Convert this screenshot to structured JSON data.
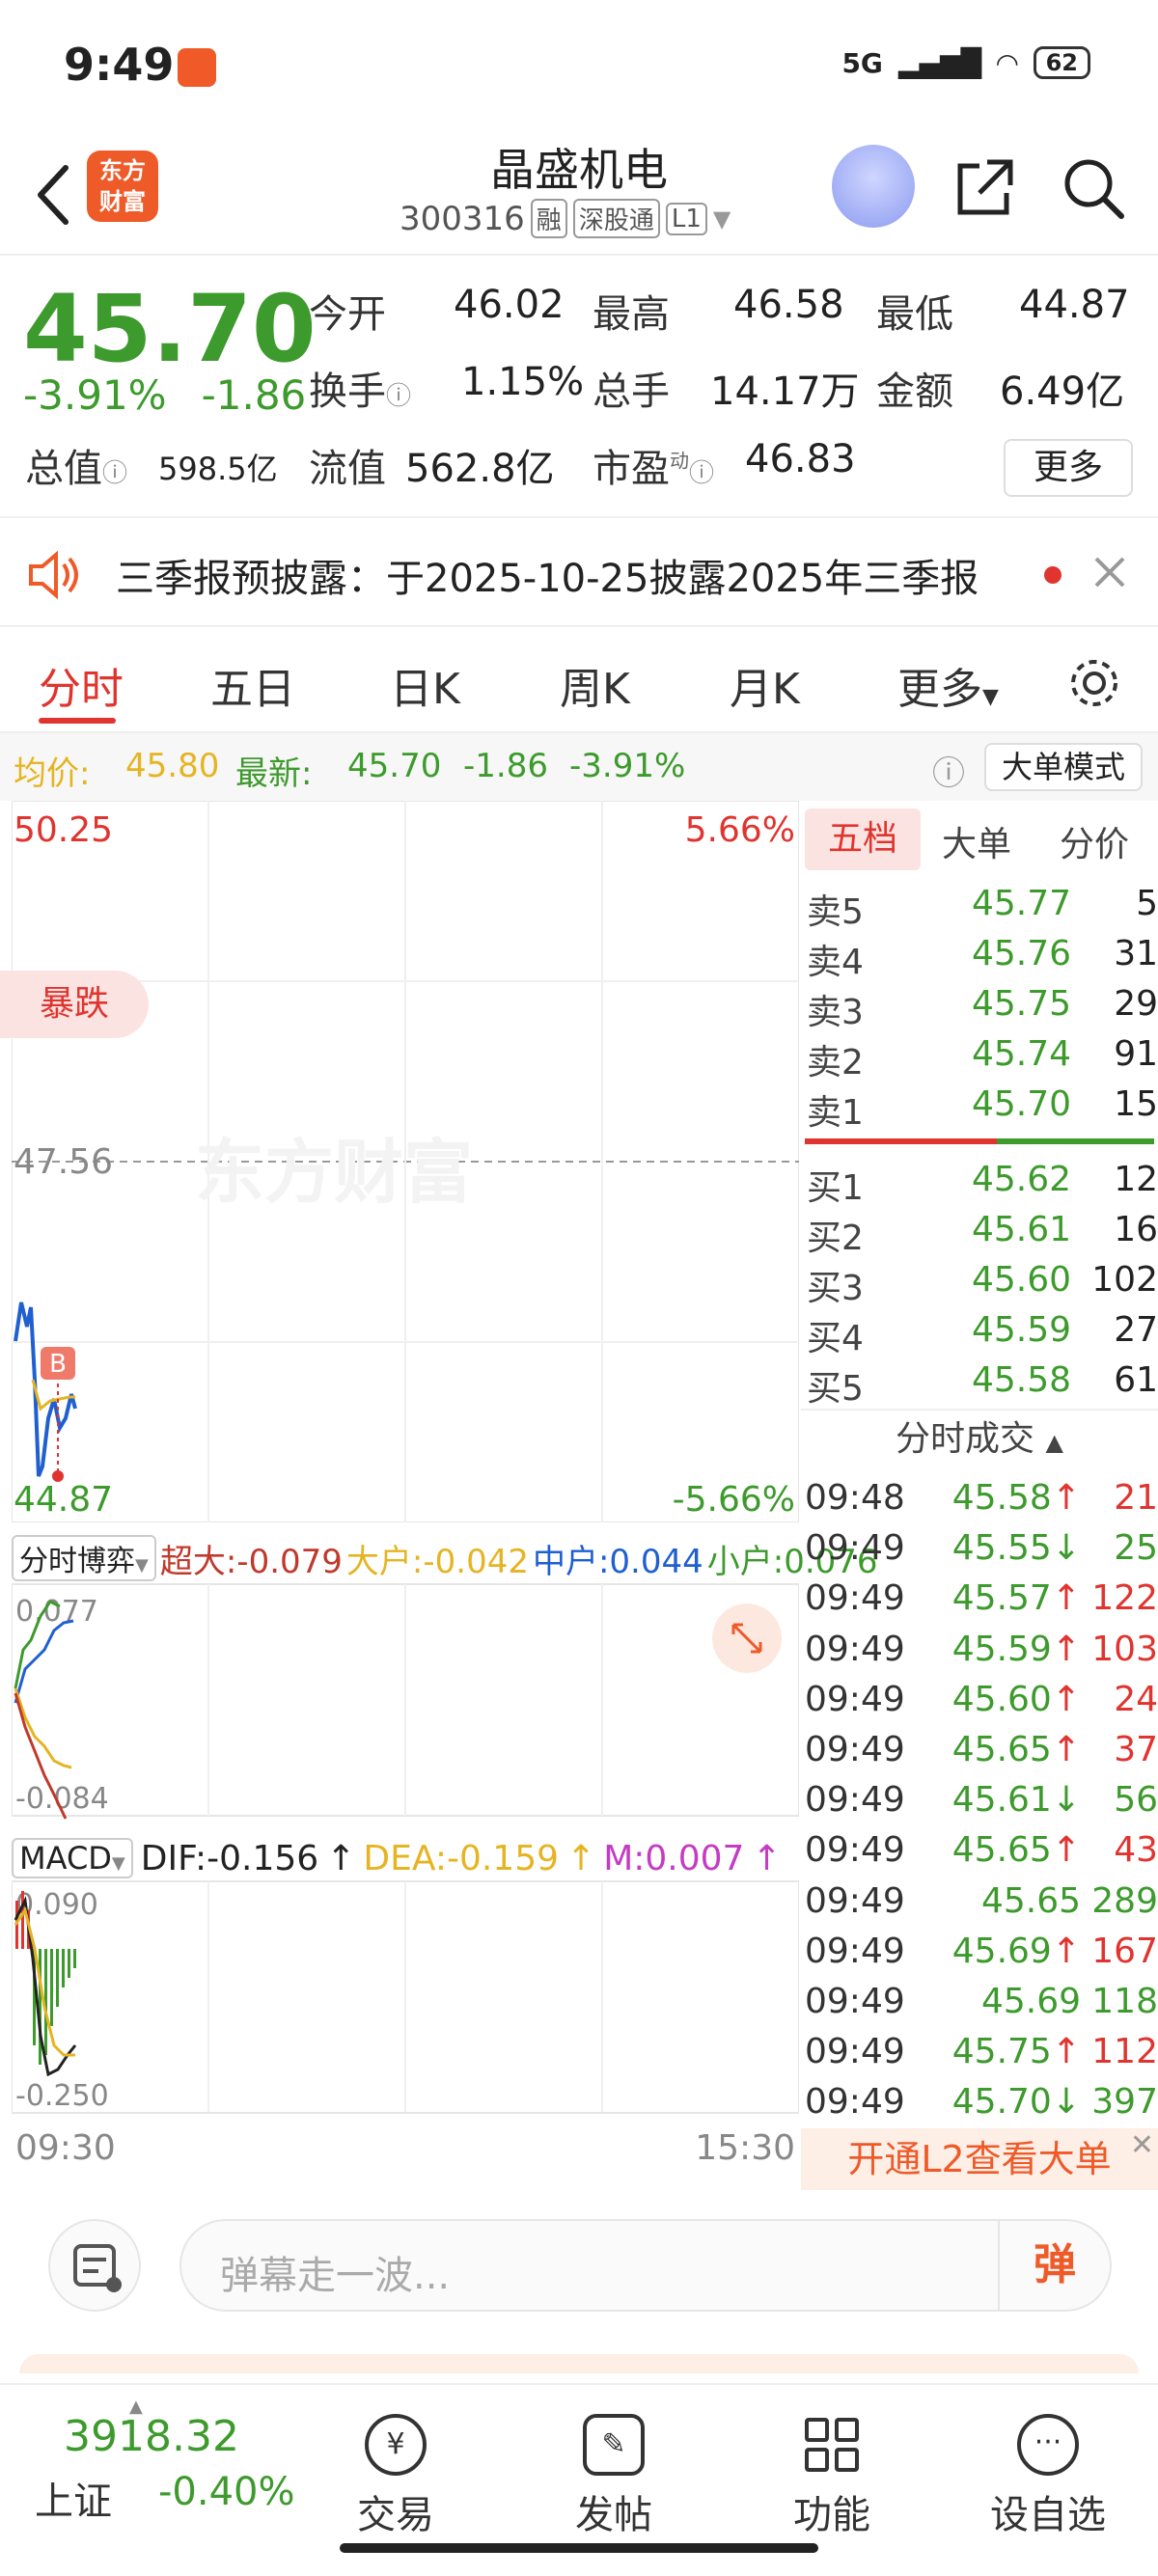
{
  "status": {
    "time": "9:49",
    "network": "5G",
    "battery": "62"
  },
  "header": {
    "logo_line1": "东方",
    "logo_line2": "财富",
    "name": "晶盛机电",
    "code": "300316",
    "tags": [
      "融",
      "深股通",
      "L1"
    ]
  },
  "quote": {
    "price": "45.70",
    "change_pct": "-3.91%",
    "change": "-1.86",
    "open_label": "今开",
    "open": "46.02",
    "high_label": "最高",
    "high": "46.58",
    "low_label": "最低",
    "low": "44.87",
    "turnover_label": "换手",
    "turnover": "1.15%",
    "volume_label": "总手",
    "volume": "14.17万",
    "amount_label": "金额",
    "amount": "6.49亿",
    "mktcap_label": "总值",
    "mktcap": "598.5亿",
    "float_label": "流值",
    "float": "562.8亿",
    "pe_label": "市盈",
    "pe_sup": "动",
    "pe": "46.83",
    "more": "更多"
  },
  "notice": {
    "text": "三季报预披露：于2025-10-25披露2025年三季报"
  },
  "tabs": [
    "分时",
    "五日",
    "日K",
    "周K",
    "月K",
    "更多"
  ],
  "avgbar": {
    "avg_label": "均价:",
    "avg": "45.80",
    "latest_label": "最新:",
    "latest": "45.70",
    "chg": "-1.86",
    "pct": "-3.91%",
    "mode": "大单模式"
  },
  "chart": {
    "top_price": "50.25",
    "top_pct": "5.66%",
    "mid_price": "47.56",
    "bot_price": "44.87",
    "bot_pct": "-5.66%",
    "badge": "暴跌",
    "watermark": "东方财富",
    "b_mark": "B",
    "flow_selector": "分时博弈",
    "flow": {
      "super": "超大:-0.079",
      "large": "大户:-0.042",
      "mid": "中户:0.044",
      "small": "小户:0.076"
    },
    "flow_top": "0.077",
    "flow_bot": "-0.084",
    "macd_selector": "MACD",
    "macd": {
      "dif": "DIF:-0.156",
      "dea": "DEA:-0.159",
      "m": "M:0.007"
    },
    "macd_top": "0.090",
    "macd_bot": "-0.250",
    "time_start": "09:30",
    "time_end": "15:30",
    "colors": {
      "up": "#e0342f",
      "down": "#3d9a2c",
      "price_line": "#1f5fd0",
      "avg_line": "#e6b422"
    }
  },
  "orderbook": {
    "tabs": [
      "五档",
      "大单",
      "分价"
    ],
    "asks": [
      {
        "label": "卖5",
        "price": "45.77",
        "vol": "5"
      },
      {
        "label": "卖4",
        "price": "45.76",
        "vol": "31"
      },
      {
        "label": "卖3",
        "price": "45.75",
        "vol": "29"
      },
      {
        "label": "卖2",
        "price": "45.74",
        "vol": "91"
      },
      {
        "label": "卖1",
        "price": "45.70",
        "vol": "15"
      }
    ],
    "bids": [
      {
        "label": "买1",
        "price": "45.62",
        "vol": "12"
      },
      {
        "label": "买2",
        "price": "45.61",
        "vol": "16"
      },
      {
        "label": "买3",
        "price": "45.60",
        "vol": "102"
      },
      {
        "label": "买4",
        "price": "45.59",
        "vol": "27"
      },
      {
        "label": "买5",
        "price": "45.58",
        "vol": "61"
      }
    ]
  },
  "trades": {
    "title": "分时成交",
    "rows": [
      {
        "time": "09:48",
        "price": "45.58",
        "dir": "↑",
        "vol": "21"
      },
      {
        "time": "09:49",
        "price": "45.55",
        "dir": "↓",
        "vol": "25"
      },
      {
        "time": "09:49",
        "price": "45.57",
        "dir": "↑",
        "vol": "122"
      },
      {
        "time": "09:49",
        "price": "45.59",
        "dir": "↑",
        "vol": "103"
      },
      {
        "time": "09:49",
        "price": "45.60",
        "dir": "↑",
        "vol": "24"
      },
      {
        "time": "09:49",
        "price": "45.65",
        "dir": "↑",
        "vol": "37"
      },
      {
        "time": "09:49",
        "price": "45.61",
        "dir": "↓",
        "vol": "56"
      },
      {
        "time": "09:49",
        "price": "45.65",
        "dir": "↑",
        "vol": "43"
      },
      {
        "time": "09:49",
        "price": "45.65",
        "dir": "",
        "vol": "289"
      },
      {
        "time": "09:49",
        "price": "45.69",
        "dir": "↑",
        "vol": "167"
      },
      {
        "time": "09:49",
        "price": "45.69",
        "dir": "",
        "vol": "118"
      },
      {
        "time": "09:49",
        "price": "45.75",
        "dir": "↑",
        "vol": "112"
      },
      {
        "time": "09:49",
        "price": "45.70",
        "dir": "↓",
        "vol": "397"
      }
    ],
    "l2_banner": "开通L2查看大单"
  },
  "danmu": {
    "placeholder": "弹幕走一波...",
    "send": "弹"
  },
  "bottom": {
    "index_value": "3918.32",
    "index_name": "上证",
    "index_pct": "-0.40%",
    "items": [
      "交易",
      "发帖",
      "功能",
      "设自选"
    ]
  }
}
